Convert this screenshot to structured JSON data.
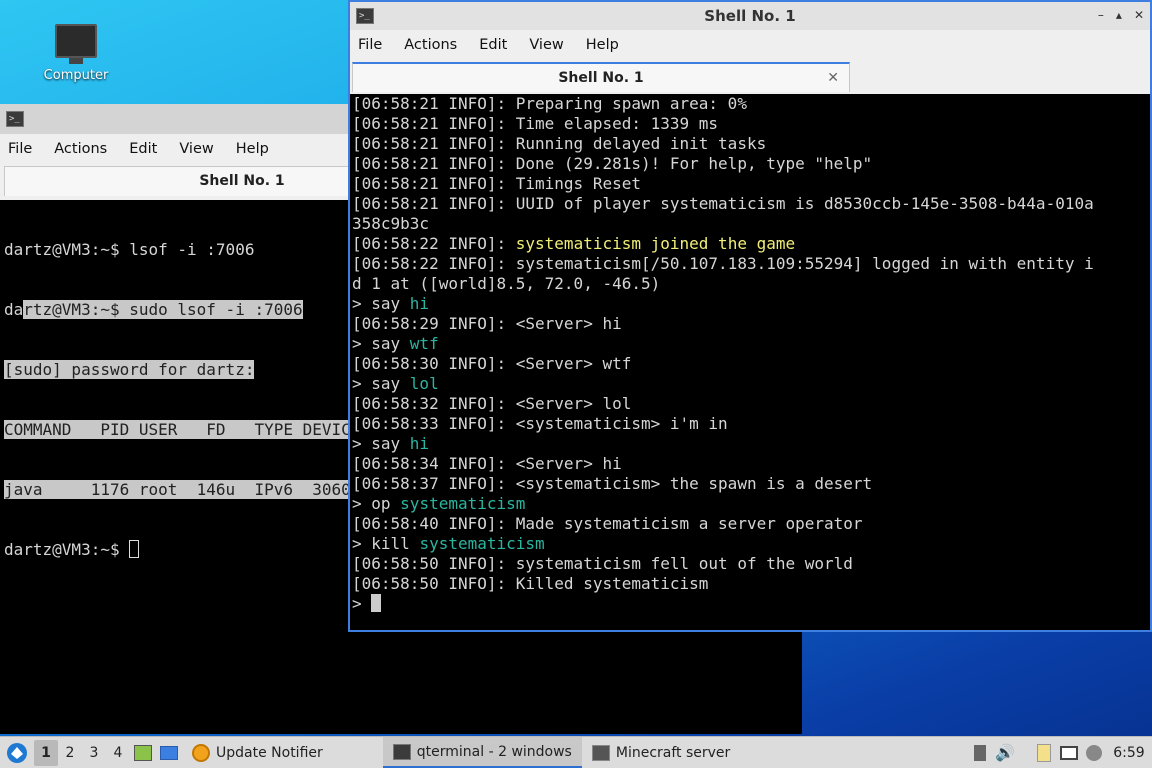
{
  "desktop": {
    "computer_label": "Computer"
  },
  "back_window": {
    "title": "Shell No. 1",
    "menu": [
      "File",
      "Actions",
      "Edit",
      "View",
      "Help"
    ],
    "tab": "Shell No. 1",
    "lines": [
      "dartz@VM3:~$ lsof -i :7006",
      "dartz@VM3:~$ sudo lsof -i :7006",
      "[sudo] password for dartz:",
      "COMMAND   PID USER   FD   TYPE DEVIC",
      "java     1176 root  146u  IPv6  3060",
      "dartz@VM3:~$ "
    ]
  },
  "front_window": {
    "title": "Shell No. 1",
    "controls": [
      "–",
      "▴",
      "✕"
    ],
    "menu": [
      "File",
      "Actions",
      "Edit",
      "View",
      "Help"
    ],
    "tab": "Shell No. 1",
    "tab_close": "✕",
    "lines": [
      [
        {
          "t": "[06:58:21 INFO]: Preparing spawn area: 0%"
        }
      ],
      [
        {
          "t": "[06:58:21 INFO]: Time elapsed: 1339 ms"
        }
      ],
      [
        {
          "t": "[06:58:21 INFO]: Running delayed init tasks"
        }
      ],
      [
        {
          "t": "[06:58:21 INFO]: Done (29.281s)! For help, type \"help\""
        }
      ],
      [
        {
          "t": "[06:58:21 INFO]: Timings Reset"
        }
      ],
      [
        {
          "t": "[06:58:21 INFO]: UUID of player systematicism is d8530ccb-145e-3508-b44a-010a"
        }
      ],
      [
        {
          "t": "358c9b3c"
        }
      ],
      [
        {
          "t": "[06:58:22 INFO]: "
        },
        {
          "t": "systematicism joined the game",
          "c": "yellow"
        }
      ],
      [
        {
          "t": "[06:58:22 INFO]: systematicism[/50.107.183.109:55294] logged in with entity i"
        }
      ],
      [
        {
          "t": "d 1 at ([world]8.5, 72.0, -46.5)"
        }
      ],
      [
        {
          "t": "> say "
        },
        {
          "t": "hi",
          "c": "teal"
        }
      ],
      [
        {
          "t": "[06:58:29 INFO]: <Server> hi"
        }
      ],
      [
        {
          "t": "> say "
        },
        {
          "t": "wtf",
          "c": "teal"
        }
      ],
      [
        {
          "t": "[06:58:30 INFO]: <Server> wtf"
        }
      ],
      [
        {
          "t": "> say "
        },
        {
          "t": "lol",
          "c": "teal"
        }
      ],
      [
        {
          "t": "[06:58:32 INFO]: <Server> lol"
        }
      ],
      [
        {
          "t": "[06:58:33 INFO]: <systematicism> i'm in"
        }
      ],
      [
        {
          "t": "> say "
        },
        {
          "t": "hi",
          "c": "teal"
        }
      ],
      [
        {
          "t": "[06:58:34 INFO]: <Server> hi"
        }
      ],
      [
        {
          "t": "[06:58:37 INFO]: <systematicism> the spawn is a desert"
        }
      ],
      [
        {
          "t": "> op "
        },
        {
          "t": "systematicism",
          "c": "teal"
        }
      ],
      [
        {
          "t": "[06:58:40 INFO]: Made systematicism a server operator"
        }
      ],
      [
        {
          "t": "> kill "
        },
        {
          "t": "systematicism",
          "c": "teal"
        }
      ],
      [
        {
          "t": "[06:58:50 INFO]: systematicism fell out of the world"
        }
      ],
      [
        {
          "t": "[06:58:50 INFO]: Killed systematicism"
        }
      ],
      [
        {
          "t": "> "
        }
      ]
    ]
  },
  "taskbar": {
    "desktops": [
      "1",
      "2",
      "3",
      "4"
    ],
    "update_notifier": "Update Notifier",
    "qterminal": "qterminal - 2 windows",
    "minecraft": "Minecraft server",
    "clock": "6:59"
  }
}
